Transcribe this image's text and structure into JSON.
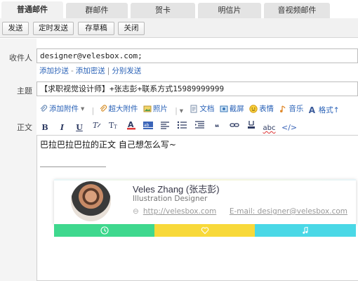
{
  "tabs": [
    {
      "label": "普通邮件",
      "active": true
    },
    {
      "label": "群邮件"
    },
    {
      "label": "贺卡"
    },
    {
      "label": "明信片"
    },
    {
      "label": "音视频邮件"
    }
  ],
  "toolbar": {
    "send": "发送",
    "scheduled_send": "定时发送",
    "save_draft": "存草稿",
    "close": "关闭"
  },
  "form": {
    "to_label": "收件人",
    "to_value": "designer@velesbox.com;",
    "add_cc": "添加抄送",
    "add_bcc": "添加密送",
    "separate_send": "分别发送",
    "subject_label": "主题",
    "subject_value": "【求职视觉设计师】+张志彭+联系方式15989999999",
    "body_label": "正文"
  },
  "attach": {
    "add_attachment": "添加附件",
    "large_attachment": "超大附件",
    "photo": "照片",
    "document": "文档",
    "screenshot": "截屏",
    "emoji": "表情",
    "music": "音乐",
    "format": "格式↑"
  },
  "editor_toolbar": [
    "B",
    "I",
    "U",
    "abc",
    "</>"
  ],
  "body": {
    "text": "巴拉巴拉巴拉的正文 自己想怎么写~"
  },
  "signature": {
    "name": "Veles Zhang (张志彭)",
    "role": "Illustration Designer",
    "website": "http://velesbox.com",
    "email": "E-mail: designer@velesbox.com",
    "bar_colors": [
      "#3fd88e",
      "#f8d93a",
      "#4ad8e6"
    ]
  }
}
